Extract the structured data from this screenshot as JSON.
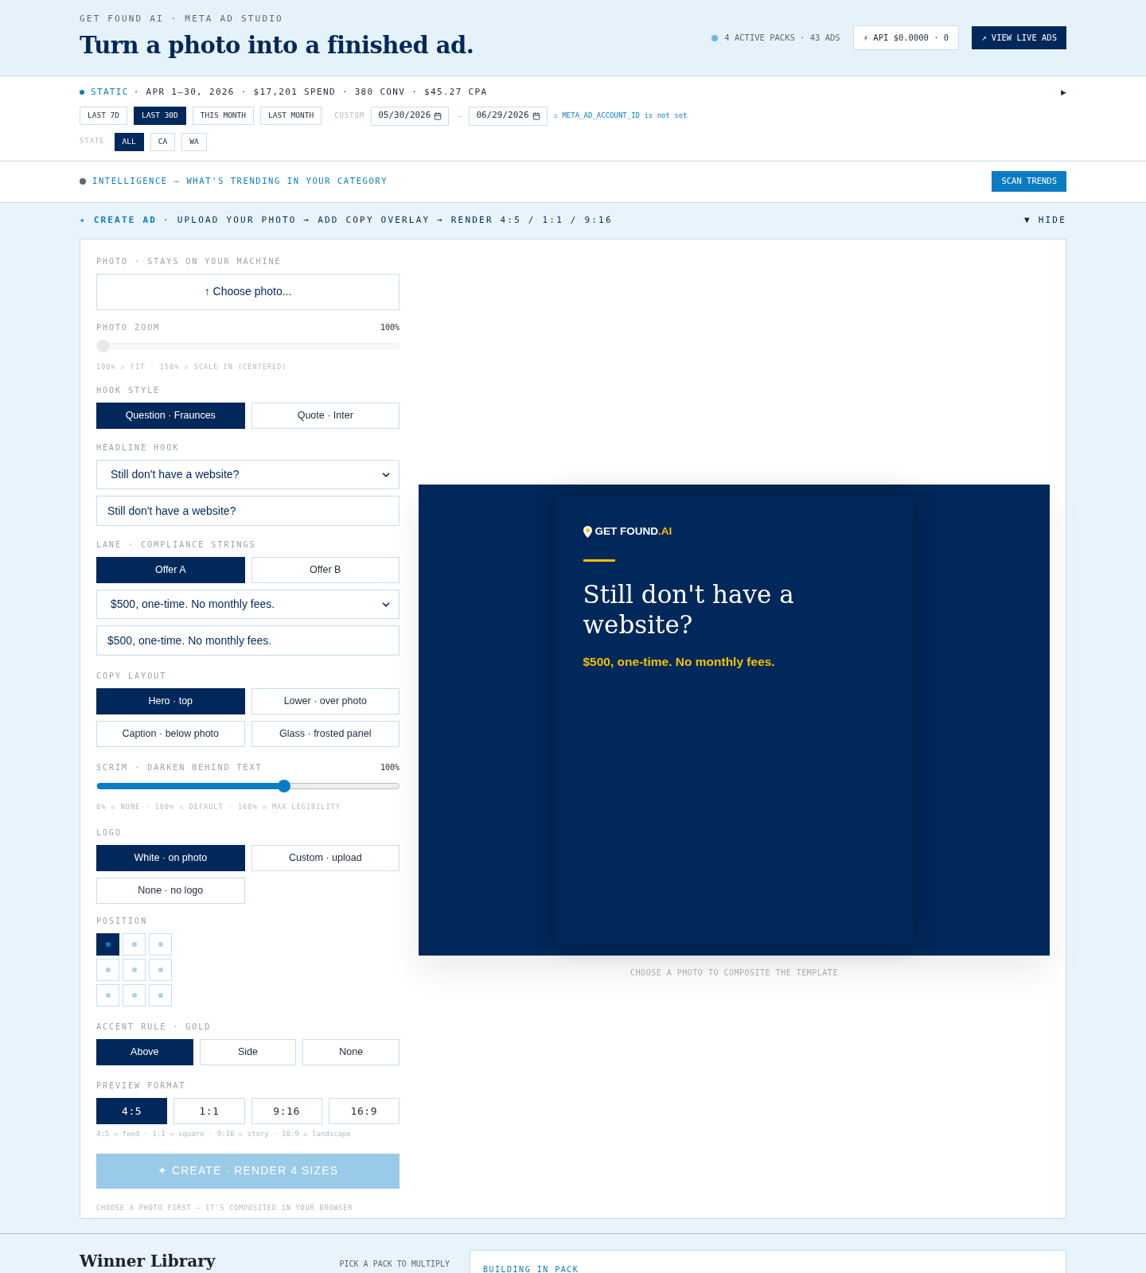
{
  "header": {
    "eyebrow": "GET FOUND AI · META AD STUDIO",
    "title": "Turn a photo into a finished ad.",
    "packs": "4 ACTIVE PACKS · 43 ADS",
    "api": "⚡ API $0.0000 · 0",
    "view_button": "↗ VIEW LIVE ADS"
  },
  "summary": {
    "mode": "STATIC",
    "stats": "· APR 1–30, 2026 · $17,201 SPEND · 380 CONV · $45.27 CPA",
    "toggle": "▶",
    "ranges": [
      {
        "label": "LAST 7D",
        "selected": false
      },
      {
        "label": "LAST 30D",
        "selected": true
      },
      {
        "label": "THIS MONTH",
        "selected": false
      },
      {
        "label": "LAST MONTH",
        "selected": false
      }
    ],
    "custom_label": "CUSTOM",
    "date_from": "05/30/2026",
    "arrow": "→",
    "date_to": "06/29/2026",
    "warning": "⚠ META_AD_ACCOUNT_ID is not set",
    "state_label": "STATE",
    "states": [
      {
        "label": "ALL",
        "selected": true
      },
      {
        "label": "CA",
        "selected": false
      },
      {
        "label": "WA",
        "selected": false
      }
    ]
  },
  "intelligence": {
    "title": "INTELLIGENCE — WHAT'S TRENDING IN YOUR CATEGORY",
    "button": "SCAN TRENDS"
  },
  "create_bar": {
    "title": "✦ CREATE AD",
    "steps": "· UPLOAD YOUR PHOTO → ADD COPY OVERLAY → RENDER 4:5 / 1:1 / 9:16",
    "hide": "▼ HIDE"
  },
  "form": {
    "photo_label": "PHOTO · STAYS ON YOUR MACHINE",
    "photo_button": "↑ Choose photo...",
    "zoom": {
      "label": "PHOTO ZOOM",
      "reading": "100%",
      "level": 0,
      "hint": "100% = FIT · 150% = SCALE IN (CENTERED)"
    },
    "hook_label": "HOOK STYLE",
    "hook_styles": [
      {
        "label": "Question · Fraunces",
        "selected": true
      },
      {
        "label": "Quote · Inter",
        "selected": false
      }
    ],
    "headline_label": "HEADLINE HOOK",
    "headline_select": "Still don't have a website?",
    "headline_input": "Still don't have a website?",
    "lane_label": "LANE · COMPLIANCE STRINGS",
    "lanes": [
      {
        "label": "Offer A",
        "selected": true
      },
      {
        "label": "Offer B",
        "selected": false
      }
    ],
    "offer_select": "$500, one-time. No monthly fees.",
    "offer_input": "$500, one-time. No monthly fees.",
    "layout_label": "COPY LAYOUT",
    "layouts": [
      {
        "label": "Hero · top",
        "selected": true
      },
      {
        "label": "Lower · over photo",
        "selected": false
      },
      {
        "label": "Caption · below photo",
        "selected": false
      },
      {
        "label": "Glass · frosted panel",
        "selected": false
      }
    ],
    "scrim": {
      "label": "SCRIM · DARKEN BEHIND TEXT",
      "reading": "100%",
      "level": 0.62,
      "hint": "0% = NONE · 100% = DEFAULT · 160% = MAX LEGIBILITY"
    },
    "logo_label": "LOGO",
    "logos": [
      {
        "label": "White · on photo",
        "selected": true
      },
      {
        "label": "Custom · upload",
        "selected": false
      },
      {
        "label": "None · no logo",
        "selected": false
      }
    ],
    "position_label": "POSITION",
    "positions": [
      {
        "selected": true
      },
      {
        "selected": false
      },
      {
        "selected": false
      },
      {
        "selected": false
      },
      {
        "selected": false
      },
      {
        "selected": false
      },
      {
        "selected": false
      },
      {
        "selected": false
      },
      {
        "selected": false
      }
    ],
    "accent_label": "ACCENT RULE · GOLD",
    "accents": [
      {
        "label": "Above",
        "selected": true
      },
      {
        "label": "Side",
        "selected": false
      },
      {
        "label": "None",
        "selected": false
      }
    ],
    "format_label": "PREVIEW FORMAT",
    "formats": [
      {
        "label": "4:5",
        "selected": true
      },
      {
        "label": "1:1",
        "selected": false
      },
      {
        "label": "9:16",
        "selected": false
      },
      {
        "label": "16:9",
        "selected": false
      }
    ],
    "format_hint": "4:5 = feed · 1:1 = square · 9:16 = story · 16:9 = landscape",
    "create_button": {
      "label": "✦ CREATE · RENDER 4 SIZES",
      "disabled": true
    },
    "create_hint": "CHOOSE A PHOTO FIRST — IT'S COMPOSITED IN YOUR BROWSER"
  },
  "preview": {
    "brand": "GET FOUND",
    "brand_suffix": ".AI",
    "headline": "Still don't have a website?",
    "offer": "$500, one-time. No monthly fees.",
    "caption": "CHOOSE A PHOTO TO COMPOSITE THE TEMPLATE"
  },
  "library": {
    "title": "Winner Library",
    "pick": "PICK A PACK TO MULTIPLY",
    "building": "BUILDING IN PACK"
  }
}
